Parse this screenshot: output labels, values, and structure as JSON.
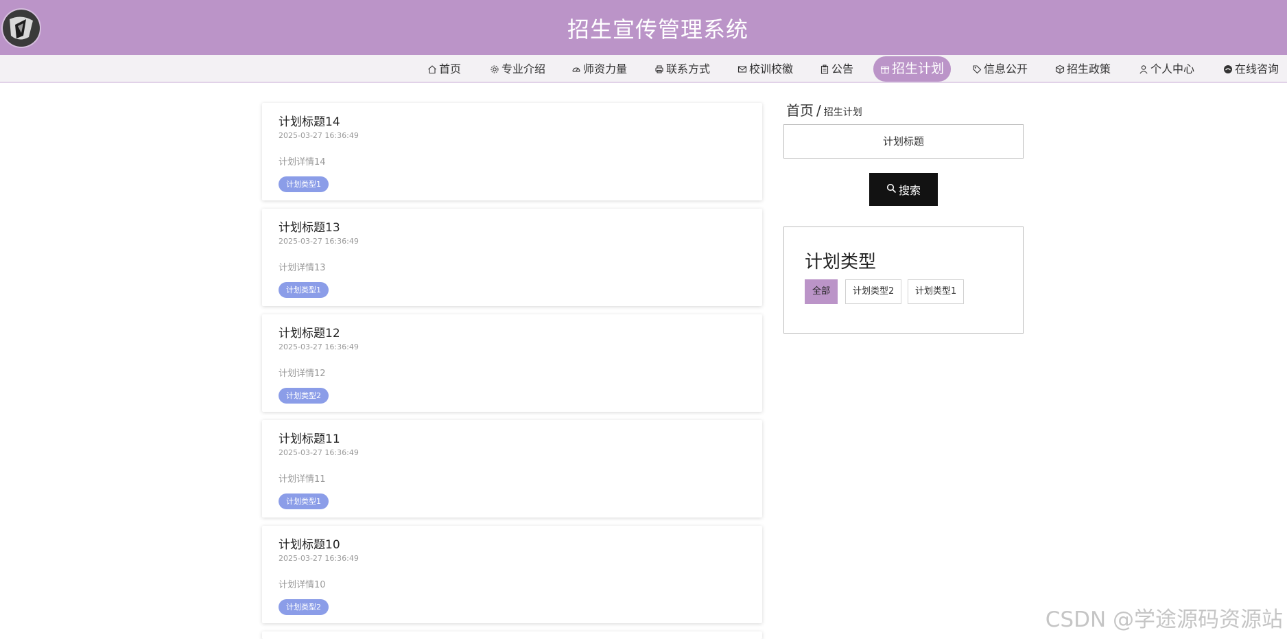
{
  "header": {
    "title": "招生宣传管理系统",
    "background_color": "#bb94c8",
    "logo_icon": "avatar-logo-icon"
  },
  "nav": {
    "items": [
      {
        "label": "首页",
        "icon": "home-icon"
      },
      {
        "label": "专业介绍",
        "icon": "gear-icon"
      },
      {
        "label": "师资力量",
        "icon": "dashboard-icon"
      },
      {
        "label": "联系方式",
        "icon": "printer-icon"
      },
      {
        "label": "校训校徽",
        "icon": "mail-icon"
      },
      {
        "label": "公告",
        "icon": "clipboard-icon"
      },
      {
        "label": "招生计划",
        "icon": "gift-icon",
        "active": true
      },
      {
        "label": "信息公开",
        "icon": "tag-icon"
      },
      {
        "label": "招生政策",
        "icon": "box-icon"
      },
      {
        "label": "个人中心",
        "icon": "user-icon"
      },
      {
        "label": "在线咨询",
        "icon": "chat-icon"
      }
    ],
    "active_color": "#bb94c8"
  },
  "plans": [
    {
      "title": "计划标题14",
      "time": "2025-03-27 16:36:49",
      "detail": "计划详情14",
      "type": "计划类型1"
    },
    {
      "title": "计划标题13",
      "time": "2025-03-27 16:36:49",
      "detail": "计划详情13",
      "type": "计划类型1"
    },
    {
      "title": "计划标题12",
      "time": "2025-03-27 16:36:49",
      "detail": "计划详情12",
      "type": "计划类型2"
    },
    {
      "title": "计划标题11",
      "time": "2025-03-27 16:36:49",
      "detail": "计划详情11",
      "type": "计划类型1"
    },
    {
      "title": "计划标题10",
      "time": "2025-03-27 16:36:49",
      "detail": "计划详情10",
      "type": "计划类型2"
    }
  ],
  "tag_color": "#8b9de8",
  "sidebar": {
    "breadcrumb": {
      "home": "首页",
      "separator": "/",
      "current": "招生计划"
    },
    "search": {
      "placeholder": "计划标题",
      "value": ""
    },
    "search_button_label": "搜索",
    "type_filter": {
      "title": "计划类型",
      "options": [
        {
          "label": "全部",
          "active": true
        },
        {
          "label": "计划类型2",
          "active": false
        },
        {
          "label": "计划类型1",
          "active": false
        }
      ]
    }
  },
  "watermark": "CSDN @学途源码资源站"
}
